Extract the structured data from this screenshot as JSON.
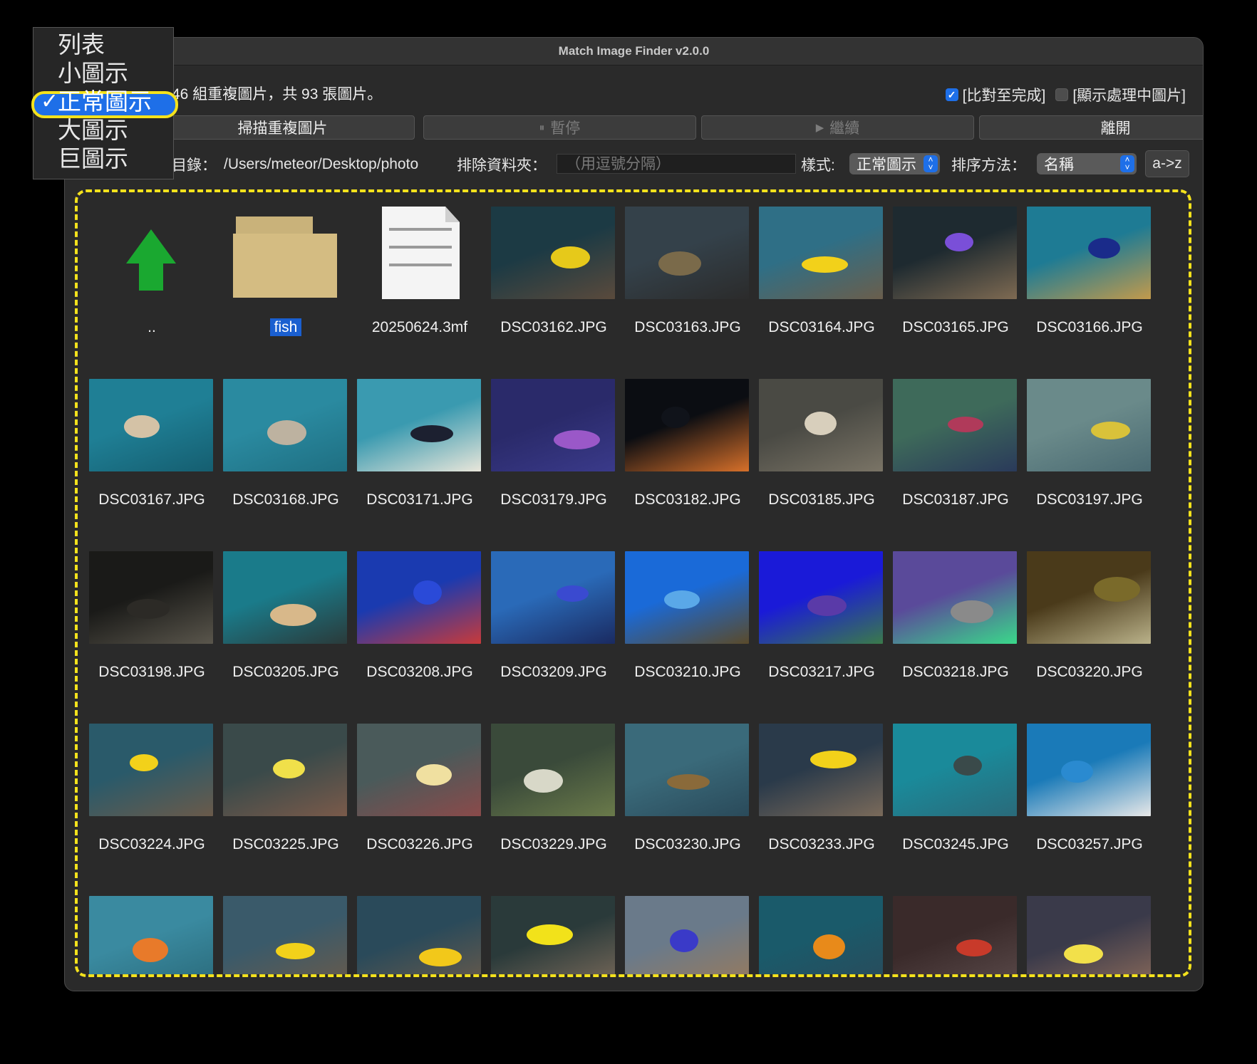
{
  "window": {
    "title": "Match Image Finder v2.0.0"
  },
  "summary": "46 組重複圖片，共 93 張圖片。",
  "checks": [
    {
      "label": "[比對至完成]",
      "checked": true
    },
    {
      "label": "[顯示處理中圖片]",
      "checked": false
    }
  ],
  "buttons": {
    "scan": "掃描重複圖片",
    "pause": "暫停",
    "resume": "繼續",
    "quit": "離開",
    "pause_icon": "⏸",
    "resume_icon": "▶"
  },
  "toolbar": {
    "dir_label": "目錄：",
    "dir_value": "/Users/meteor/Desktop/photo",
    "exclude_label": "排除資料夾：",
    "exclude_placeholder": "（用逗號分隔）",
    "style_label": "樣式:",
    "style_value": "正常圖示",
    "sort_label": "排序方法：",
    "sort_value": "名稱",
    "order": "a->z"
  },
  "menu": {
    "items": [
      "列表",
      "小圖示",
      "正常圖示",
      "大圖示",
      "巨圖示"
    ],
    "selected": "正常圖示",
    "tick": "✓"
  },
  "files": [
    {
      "name": "..",
      "kind": "up"
    },
    {
      "name": "fish",
      "kind": "folder",
      "selected": true
    },
    {
      "name": "20250624.3mf",
      "kind": "doc"
    },
    {
      "name": "DSC03162.JPG",
      "kind": "img",
      "colors": [
        "#1c3a44",
        "#e6c91a",
        "#5a4a3c"
      ]
    },
    {
      "name": "DSC03163.JPG",
      "kind": "img",
      "colors": [
        "#34414a",
        "#7a6a4a",
        "#2b2b2b"
      ]
    },
    {
      "name": "DSC03164.JPG",
      "kind": "img",
      "colors": [
        "#2f6f86",
        "#f2d11a",
        "#6a5e4c"
      ]
    },
    {
      "name": "DSC03165.JPG",
      "kind": "img",
      "colors": [
        "#1e2a30",
        "#7a4fd8",
        "#7e6a52"
      ]
    },
    {
      "name": "DSC03166.JPG",
      "kind": "img",
      "colors": [
        "#1e7b94",
        "#1a2b8a",
        "#c29a4c"
      ]
    },
    {
      "name": "DSC03167.JPG",
      "kind": "img",
      "colors": [
        "#1f7f95",
        "#d4c2a6",
        "#155e70"
      ]
    },
    {
      "name": "DSC03168.JPG",
      "kind": "img",
      "colors": [
        "#2a8aa0",
        "#bdb2a0",
        "#1f6f82"
      ]
    },
    {
      "name": "DSC03171.JPG",
      "kind": "img",
      "colors": [
        "#3a9ab0",
        "#1c2030",
        "#e9e6da"
      ]
    },
    {
      "name": "DSC03179.JPG",
      "kind": "img",
      "colors": [
        "#2a2a6a",
        "#9a58c8",
        "#3a3a8a"
      ]
    },
    {
      "name": "DSC03182.JPG",
      "kind": "img",
      "colors": [
        "#0b0d12",
        "#10131a",
        "#d7702a"
      ]
    },
    {
      "name": "DSC03185.JPG",
      "kind": "img",
      "colors": [
        "#4a4a44",
        "#d8cfbc",
        "#7a7466"
      ]
    },
    {
      "name": "DSC03187.JPG",
      "kind": "img",
      "colors": [
        "#3e6a5a",
        "#b03a5a",
        "#2a3a5a"
      ]
    },
    {
      "name": "DSC03197.JPG",
      "kind": "img",
      "colors": [
        "#6a8a8a",
        "#d9c23a",
        "#4a6a72"
      ]
    },
    {
      "name": "DSC03198.JPG",
      "kind": "img",
      "colors": [
        "#1a1a18",
        "#2c2a26",
        "#5a564c"
      ]
    },
    {
      "name": "DSC03205.JPG",
      "kind": "img",
      "colors": [
        "#1a7b8a",
        "#d8b88a",
        "#2a3a3a"
      ]
    },
    {
      "name": "DSC03208.JPG",
      "kind": "img",
      "colors": [
        "#1a3ab0",
        "#2a4ad8",
        "#c83a3a"
      ]
    },
    {
      "name": "DSC03209.JPG",
      "kind": "img",
      "colors": [
        "#2a6ab8",
        "#3a4ad0",
        "#1a2a60"
      ]
    },
    {
      "name": "DSC03210.JPG",
      "kind": "img",
      "colors": [
        "#1a6ad8",
        "#5aa8e8",
        "#5a4a2a"
      ]
    },
    {
      "name": "DSC03217.JPG",
      "kind": "img",
      "colors": [
        "#1a1ad8",
        "#5a3aa8",
        "#3a7a4a"
      ]
    },
    {
      "name": "DSC03218.JPG",
      "kind": "img",
      "colors": [
        "#5a4a9a",
        "#8a8a8a",
        "#3ad88a"
      ]
    },
    {
      "name": "DSC03220.JPG",
      "kind": "img",
      "colors": [
        "#4a3a1a",
        "#7a6a2a",
        "#bab28a"
      ]
    },
    {
      "name": "DSC03224.JPG",
      "kind": "img",
      "colors": [
        "#2a5a6a",
        "#f2d11a",
        "#6a5a4a"
      ]
    },
    {
      "name": "DSC03225.JPG",
      "kind": "img",
      "colors": [
        "#3a4a4a",
        "#f0e04a",
        "#7a5a4a"
      ]
    },
    {
      "name": "DSC03226.JPG",
      "kind": "img",
      "colors": [
        "#4a5a5a",
        "#f0e0a0",
        "#8a4a4a"
      ]
    },
    {
      "name": "DSC03229.JPG",
      "kind": "img",
      "colors": [
        "#3a4a3a",
        "#d8d8c8",
        "#6a7a4a"
      ]
    },
    {
      "name": "DSC03230.JPG",
      "kind": "img",
      "colors": [
        "#3a6a7a",
        "#8a6a3a",
        "#2a4a5a"
      ]
    },
    {
      "name": "DSC03233.JPG",
      "kind": "img",
      "colors": [
        "#2a3a4a",
        "#f2d11a",
        "#7a6a5a"
      ]
    },
    {
      "name": "DSC03245.JPG",
      "kind": "img",
      "colors": [
        "#1a8a9a",
        "#3a4a4a",
        "#2a6a7a"
      ]
    },
    {
      "name": "DSC03257.JPG",
      "kind": "img",
      "colors": [
        "#1a7ab8",
        "#2a8ad0",
        "#e8e8e8"
      ]
    },
    {
      "name": "",
      "kind": "img",
      "colors": [
        "#3a8aa0",
        "#e87a2a",
        "#2a6a7a"
      ]
    },
    {
      "name": "",
      "kind": "img",
      "colors": [
        "#3a5a6a",
        "#f2d11a",
        "#6a5a4a"
      ]
    },
    {
      "name": "",
      "kind": "img",
      "colors": [
        "#2a4a5a",
        "#f2c81a",
        "#6a5a4a"
      ]
    },
    {
      "name": "",
      "kind": "img",
      "colors": [
        "#2a3a3a",
        "#f2e21a",
        "#7a6a5a"
      ]
    },
    {
      "name": "",
      "kind": "img",
      "colors": [
        "#6a7a8a",
        "#3a3ac8",
        "#9a7a5a"
      ]
    },
    {
      "name": "",
      "kind": "img",
      "colors": [
        "#1a5a6a",
        "#e88a1a",
        "#2a4a5a"
      ]
    },
    {
      "name": "",
      "kind": "img",
      "colors": [
        "#3a2a2a",
        "#c83a2a",
        "#5a4a4a"
      ]
    },
    {
      "name": "",
      "kind": "img",
      "colors": [
        "#3a3a4a",
        "#f2e04a",
        "#8a6a5a"
      ]
    }
  ]
}
